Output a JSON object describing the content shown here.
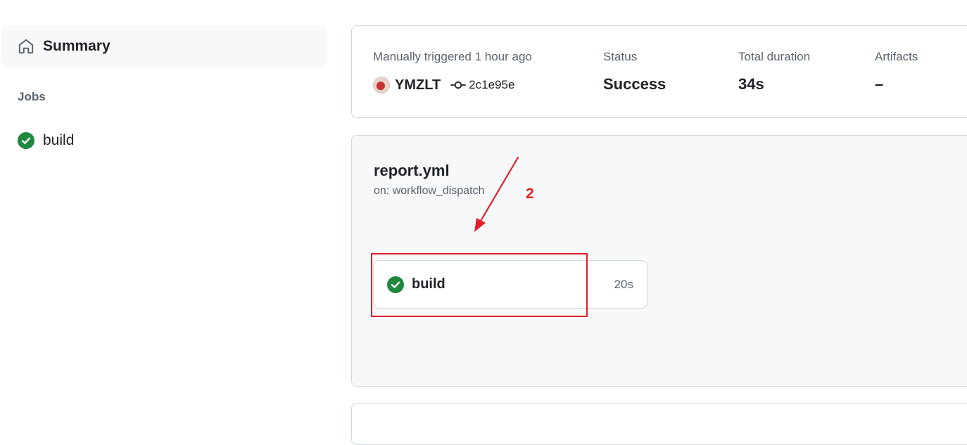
{
  "sidebar": {
    "summary_label": "Summary",
    "jobs_heading": "Jobs",
    "jobs": [
      {
        "label": "build",
        "status": "success"
      }
    ]
  },
  "run_summary": {
    "trigger_text": "Manually triggered 1 hour ago",
    "actor": "YMZLT",
    "commit_sha": "2c1e95e",
    "status_label": "Status",
    "status_value": "Success",
    "duration_label": "Total duration",
    "duration_value": "34s",
    "artifacts_label": "Artifacts",
    "artifacts_value": "–"
  },
  "workflow": {
    "file_name": "report.yml",
    "trigger": "on: workflow_dispatch",
    "job": {
      "label": "build",
      "duration": "20s",
      "status": "success"
    }
  },
  "annotation": {
    "number": "2",
    "color": "#e0202a"
  },
  "colors": {
    "success": "#1f883d",
    "muted_text": "#59636e",
    "border": "#d1d9e0",
    "panel_bg": "#f6f8fa"
  },
  "icons": {
    "summary": "home-icon",
    "job_status": "check-circle-icon",
    "commit": "git-commit-icon"
  }
}
